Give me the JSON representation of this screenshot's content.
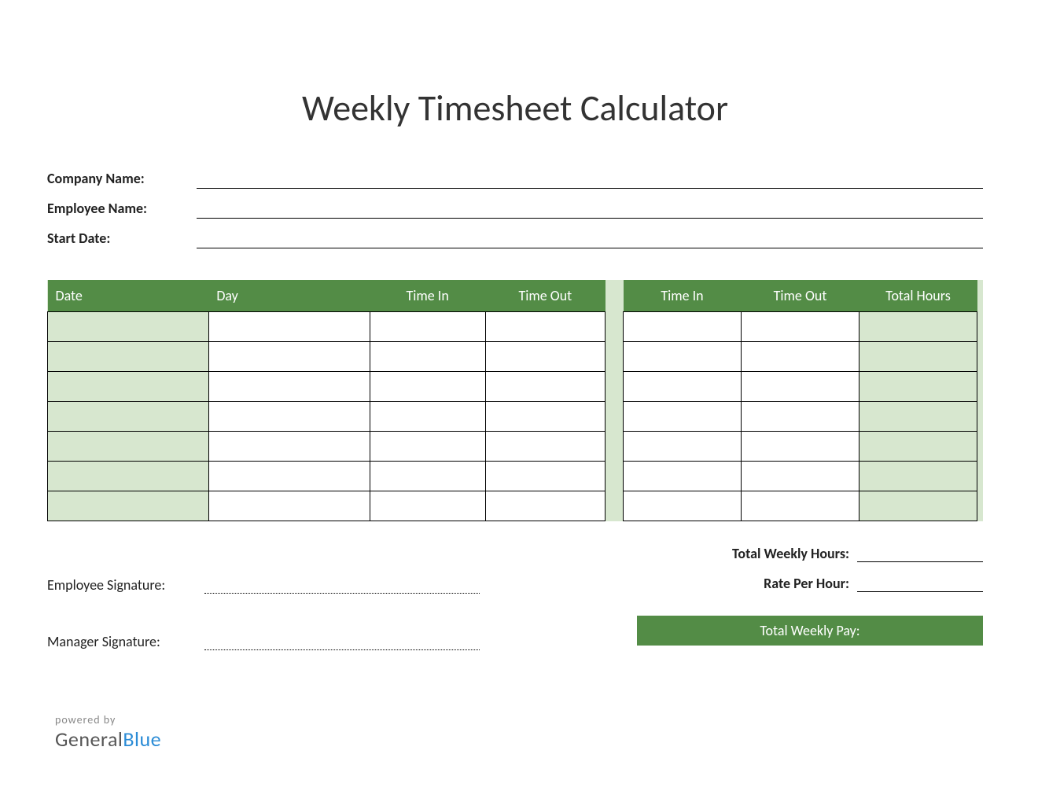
{
  "title": "Weekly Timesheet Calculator",
  "meta": {
    "company_label": "Company Name:",
    "employee_label": "Employee Name:",
    "startdate_label": "Start Date:",
    "company_value": "",
    "employee_value": "",
    "startdate_value": ""
  },
  "table_left": {
    "headers": {
      "date": "Date",
      "day": "Day",
      "time_in": "Time In",
      "time_out": "Time Out"
    },
    "rows": [
      {
        "date": "",
        "day": "",
        "time_in": "",
        "time_out": ""
      },
      {
        "date": "",
        "day": "",
        "time_in": "",
        "time_out": ""
      },
      {
        "date": "",
        "day": "",
        "time_in": "",
        "time_out": ""
      },
      {
        "date": "",
        "day": "",
        "time_in": "",
        "time_out": ""
      },
      {
        "date": "",
        "day": "",
        "time_in": "",
        "time_out": ""
      },
      {
        "date": "",
        "day": "",
        "time_in": "",
        "time_out": ""
      },
      {
        "date": "",
        "day": "",
        "time_in": "",
        "time_out": ""
      }
    ]
  },
  "table_right": {
    "headers": {
      "time_in": "Time In",
      "time_out": "Time Out",
      "total_hours": "Total Hours"
    },
    "rows": [
      {
        "time_in": "",
        "time_out": "",
        "total_hours": ""
      },
      {
        "time_in": "",
        "time_out": "",
        "total_hours": ""
      },
      {
        "time_in": "",
        "time_out": "",
        "total_hours": ""
      },
      {
        "time_in": "",
        "time_out": "",
        "total_hours": ""
      },
      {
        "time_in": "",
        "time_out": "",
        "total_hours": ""
      },
      {
        "time_in": "",
        "time_out": "",
        "total_hours": ""
      },
      {
        "time_in": "",
        "time_out": "",
        "total_hours": ""
      }
    ]
  },
  "signatures": {
    "employee_label": "Employee Signature:",
    "manager_label": "Manager Signature:"
  },
  "totals": {
    "weekly_hours_label": "Total Weekly Hours:",
    "rate_label": "Rate Per Hour:",
    "pay_label": "Total Weekly Pay:",
    "weekly_hours_value": "",
    "rate_value": "",
    "pay_value": ""
  },
  "branding": {
    "powered_by": "powered by",
    "name1": "General",
    "name2": "Blue"
  }
}
